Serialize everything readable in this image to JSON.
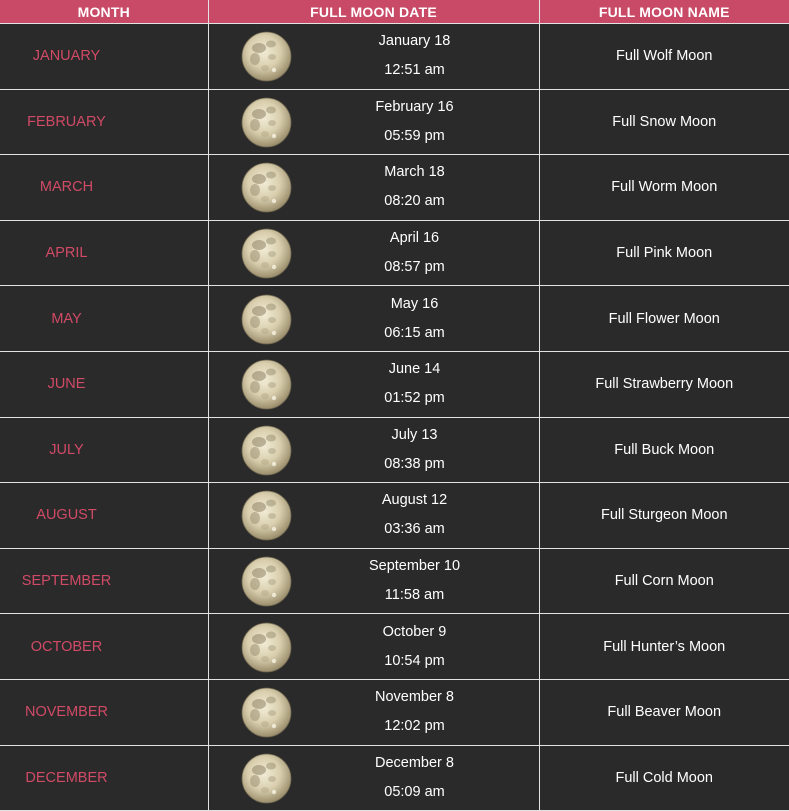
{
  "header": {
    "month": "MONTH",
    "date": "FULL MOON DATE",
    "name": "FULL MOON NAME"
  },
  "rows": [
    {
      "month": "JANUARY",
      "date": "January 18",
      "time": "12:51 am",
      "name": "Full Wolf Moon"
    },
    {
      "month": "FEBRUARY",
      "date": "February 16",
      "time": "05:59 pm",
      "name": "Full Snow Moon"
    },
    {
      "month": "MARCH",
      "date": "March 18",
      "time": "08:20 am",
      "name": "Full Worm Moon"
    },
    {
      "month": "APRIL",
      "date": "April 16",
      "time": "08:57 pm",
      "name": "Full Pink Moon"
    },
    {
      "month": "MAY",
      "date": "May 16",
      "time": "06:15 am",
      "name": "Full Flower Moon"
    },
    {
      "month": "JUNE",
      "date": "June 14",
      "time": "01:52 pm",
      "name": "Full Strawberry Moon"
    },
    {
      "month": "JULY",
      "date": "July 13",
      "time": "08:38 pm",
      "name": "Full Buck Moon"
    },
    {
      "month": "AUGUST",
      "date": "August 12",
      "time": "03:36 am",
      "name": "Full Sturgeon Moon"
    },
    {
      "month": "SEPTEMBER",
      "date": "September 10",
      "time": "11:58 am",
      "name": "Full Corn Moon"
    },
    {
      "month": "OCTOBER",
      "date": "October 9",
      "time": "10:54 pm",
      "name": "Full Hunter’s Moon"
    },
    {
      "month": "NOVEMBER",
      "date": "November 8",
      "time": "12:02 pm",
      "name": "Full Beaver Moon"
    },
    {
      "month": "DECEMBER",
      "date": "December 8",
      "time": "05:09 am",
      "name": "Full Cold Moon"
    }
  ],
  "colors": {
    "header_bg": "#c94a67",
    "month_text": "#d14a66",
    "row_bg": "#2a2a2a",
    "border": "#e3e3e3"
  },
  "icons": {
    "moon": "full-moon-icon"
  }
}
